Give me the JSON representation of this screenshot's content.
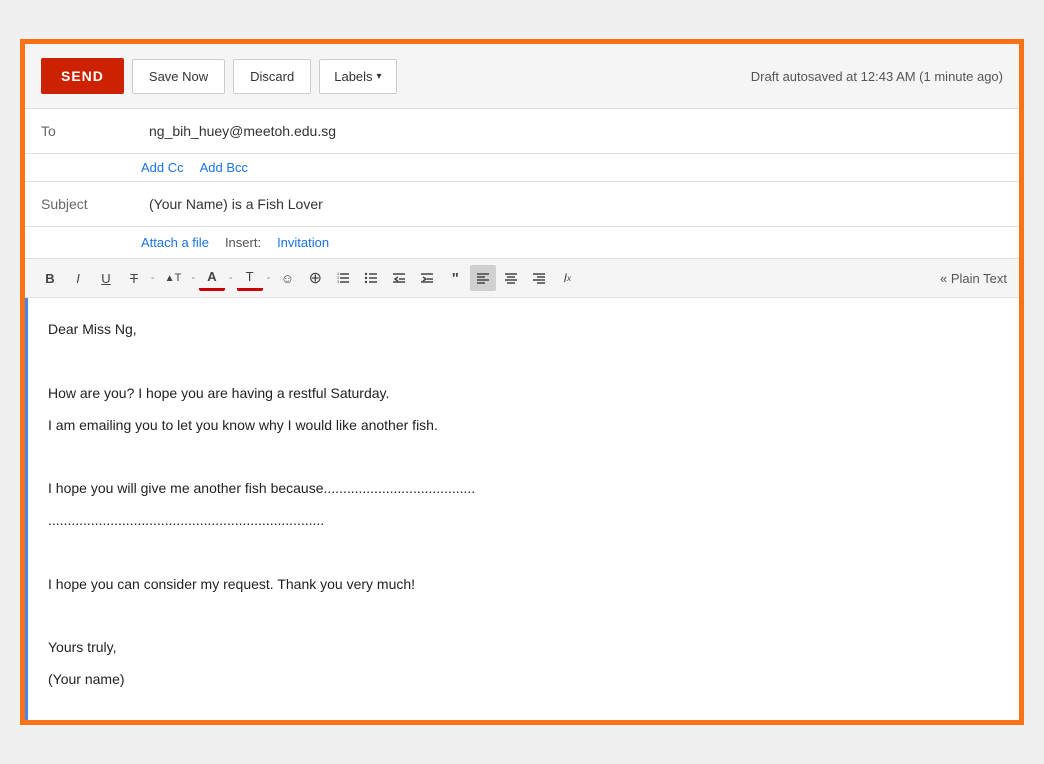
{
  "toolbar": {
    "send_label": "SEND",
    "save_now_label": "Save Now",
    "discard_label": "Discard",
    "labels_label": "Labels",
    "draft_status": "Draft autosaved at 12:43 AM (1 minute ago)"
  },
  "fields": {
    "to_label": "To",
    "to_value": "ng_bih_huey@meetoh.edu.sg",
    "add_cc": "Add Cc",
    "add_bcc": "Add Bcc",
    "subject_label": "Subject",
    "subject_value": "(Your Name) is a Fish Lover",
    "attach_file": "Attach a file",
    "insert_label": "Insert:",
    "invitation_label": "Invitation"
  },
  "formatting": {
    "bold": "B",
    "italic": "I",
    "underline": "U",
    "strikethrough": "T",
    "font_size": "T",
    "font_color": "A",
    "text_color": "T",
    "emoji": "☺",
    "link": "∞",
    "numbered_list": "≡",
    "bullet_list": "≡",
    "indent_less": "◁",
    "indent_more": "▷",
    "quote": "❝❝",
    "align_left": "≡",
    "align_center": "≡",
    "align_right": "≡",
    "remove_formatting": "Ix",
    "plain_text": "« Plain Text"
  },
  "body": {
    "line1": "Dear Miss Ng,",
    "line2": "",
    "line3": "How are you? I hope you are having a restful Saturday.",
    "line4": "I am emailing you to let you know why I would like another fish.",
    "line5": "",
    "line6": "I hope you will give me another fish because.......................................",
    "line7": ".......................................................................",
    "line8": "",
    "line9": "I hope you can consider my request. Thank you very much!",
    "line10": "",
    "line11": "Yours truly,",
    "line12": "(Your name)"
  }
}
